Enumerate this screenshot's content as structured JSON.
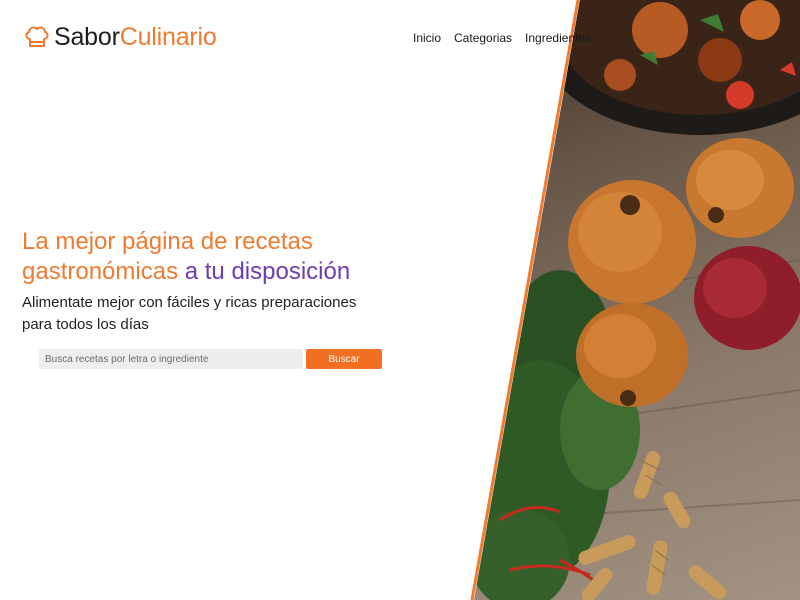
{
  "brand": {
    "name_part1": "Sabor",
    "name_part2": "Culinario",
    "accent_color": "#ef7a30",
    "logo_icon": "chef-hat-icon"
  },
  "nav": {
    "items": [
      {
        "label": "Inicio"
      },
      {
        "label": "Categorias"
      },
      {
        "label": "Ingredientes"
      }
    ]
  },
  "hero": {
    "headline_orange": "La mejor página de recetas gastronómicas",
    "headline_purple": "a tu disposición",
    "subtitle": "Alimentate mejor con fáciles y ricas preparaciones para todos los días",
    "headline_orange_color": "#ef7a30",
    "headline_purple_color": "#6d3bb5"
  },
  "search": {
    "placeholder": "Busca recetas por letra o ingrediente",
    "value": "",
    "button_label": "Buscar",
    "button_color": "#f26f22"
  },
  "hero_image": {
    "description_icon": "food-photo-icon"
  }
}
